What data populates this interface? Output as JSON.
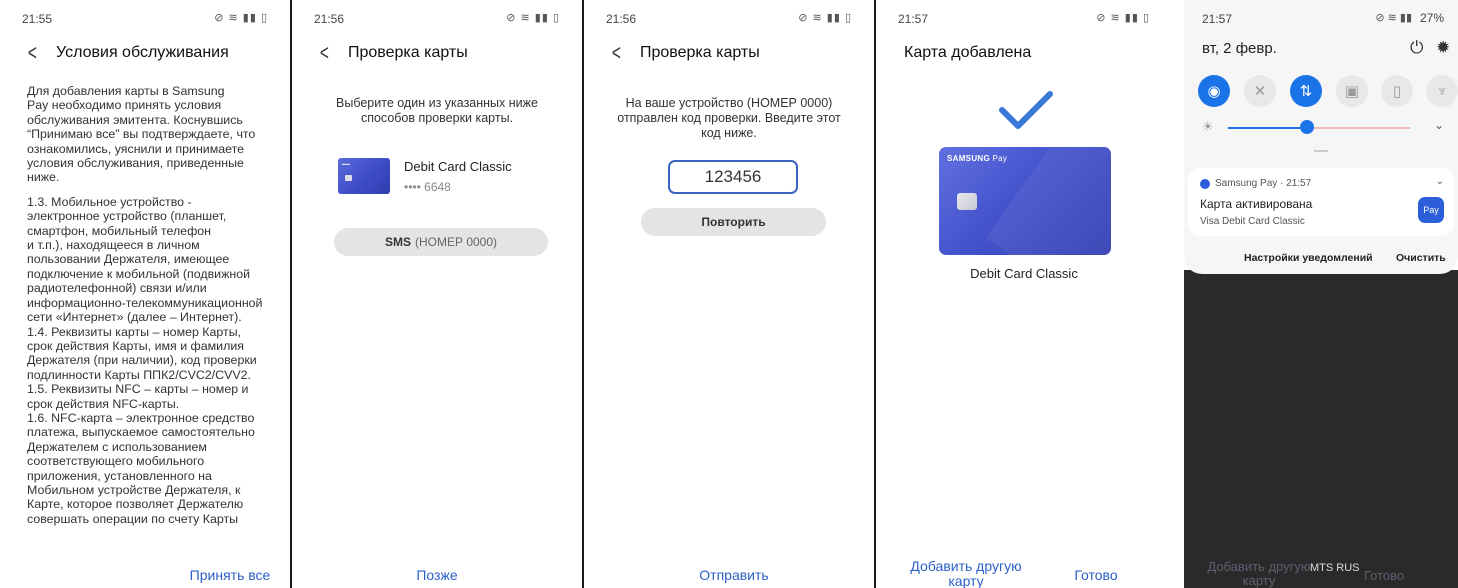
{
  "screens": [
    {
      "time": "21:55",
      "title": "Условия обслуживания",
      "paragraphs": [
        "Для добавления карты в Samsung\nPay необходимо принять условия\nобслуживания эмитента. Коснувшись\n“Принимаю все” вы подтверждаете, что\nознакомились, уяснили и принимаете\nусловия обслуживания, приведенные\nниже.",
        "1.3. Мобильное устройство -\nэлектронное устройство (планшет,\nсмартфон, мобильный телефон\nи т.п.), находящееся в личном\nпользовании Держателя, имеющее\nподключение к мобильной (подвижной\nрадиотелефонной) связи и/или\nинформационно-телекоммуникационной\nсети «Интернет» (далее – Интернет).\n1.4. Реквизиты карты – номер Карты,\nсрок действия Карты, имя и фамилия\nДержателя (при наличии), код проверки\nподлинности Карты ППК2/CVC2/CVV2.\n1.5. Реквизиты NFC – карты – номер и\nсрок действия NFC-карты.\n1.6. NFC-карта – электронное средство\nплатежа, выпускаемое самостоятельно\nДержателем с использованием\nсоответствующего мобильного\nприложения, установленного на\nМобильном устройстве Держателя, к\nКарте, которое позволяет Держателю\nсовершать операции по счету Карты"
      ],
      "action": "Принять все"
    },
    {
      "time": "21:56",
      "title": "Проверка карты",
      "instruction": "Выберите один из указанных ниже\nспособов проверки карты.",
      "card_name": "Debit Card Classic",
      "card_mask": "•••• 6648",
      "method_bold": "SMS",
      "method_muted": "(НОМЕР 0000)",
      "action": "Позже"
    },
    {
      "time": "21:56",
      "title": "Проверка карты",
      "instruction": "На ваше устройство (НОМЕР 0000)\nотправлен код проверки. Введите этот\nкод ниже.",
      "code": "123456",
      "retry": "Повторить",
      "action": "Отправить"
    },
    {
      "time": "21:57",
      "title": "Карта добавлена",
      "card_brand": "SAMSUNG",
      "card_brand_suffix": "Pay",
      "card_name": "Debit Card Classic",
      "action_left": "Добавить другую\nкарту",
      "action_right": "Готово"
    },
    {
      "time": "21:57",
      "battery": "27%",
      "date": "вт, 2 февр.",
      "notif_app": "Samsung Pay",
      "notif_time": "21:57",
      "notif_title": "Карта активирована",
      "notif_body": "Visa Debit Card Classic",
      "notif_badge": "Pay",
      "settings_label": "Настройки уведомлений",
      "clear_label": "Очистить",
      "bg_left": "Добавить другую\nкарту",
      "bg_right": "Готово",
      "carrier": "MTS RUS"
    }
  ]
}
